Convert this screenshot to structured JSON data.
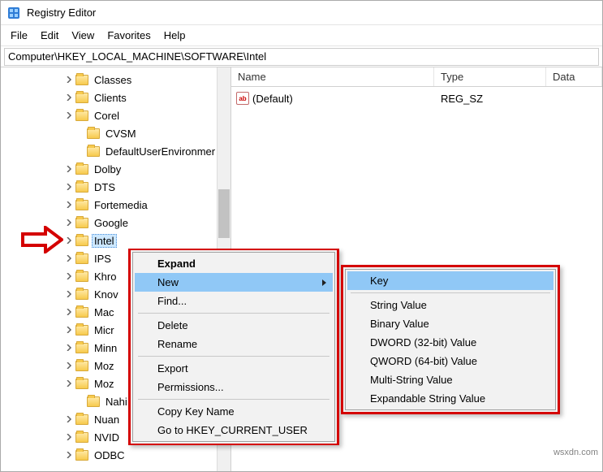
{
  "title": "Registry Editor",
  "menu": {
    "file": "File",
    "edit": "Edit",
    "view": "View",
    "favorites": "Favorites",
    "help": "Help"
  },
  "address": "Computer\\HKEY_LOCAL_MACHINE\\SOFTWARE\\Intel",
  "columns": {
    "name": "Name",
    "type": "Type",
    "data": "Data"
  },
  "value_row": {
    "name": "(Default)",
    "type": "REG_SZ"
  },
  "tree": {
    "items": [
      {
        "label": "Classes"
      },
      {
        "label": "Clients"
      },
      {
        "label": "Corel"
      },
      {
        "label": "CVSM"
      },
      {
        "label": "DefaultUserEnvironmer"
      },
      {
        "label": "Dolby"
      },
      {
        "label": "DTS"
      },
      {
        "label": "Fortemedia"
      },
      {
        "label": "Google"
      },
      {
        "label": "Intel"
      },
      {
        "label": "IPS"
      },
      {
        "label": "Khro"
      },
      {
        "label": "Knov"
      },
      {
        "label": "Mac"
      },
      {
        "label": "Micr"
      },
      {
        "label": "Minn"
      },
      {
        "label": "Moz"
      },
      {
        "label": "Moz"
      },
      {
        "label": "Nahi"
      },
      {
        "label": "Nuan"
      },
      {
        "label": "NVID"
      },
      {
        "label": "ODBC"
      }
    ]
  },
  "ctx": {
    "expand": "Expand",
    "new": "New",
    "find": "Find...",
    "delete": "Delete",
    "rename": "Rename",
    "export": "Export",
    "permissions": "Permissions...",
    "copykey": "Copy Key Name",
    "goto": "Go to HKEY_CURRENT_USER"
  },
  "sub": {
    "key": "Key",
    "string": "String Value",
    "binary": "Binary Value",
    "dword": "DWORD (32-bit) Value",
    "qword": "QWORD (64-bit) Value",
    "multi": "Multi-String Value",
    "expand": "Expandable String Value"
  },
  "watermark": "wsxdn.com"
}
